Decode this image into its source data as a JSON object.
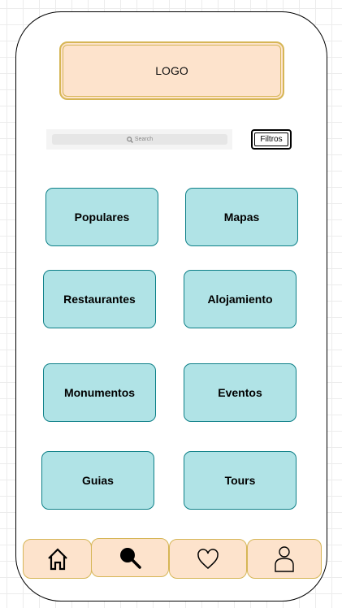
{
  "header": {
    "logo_text": "LOGO"
  },
  "search": {
    "placeholder": "Search",
    "icon": "search-icon"
  },
  "filters": {
    "label": "Filtros"
  },
  "categories": [
    {
      "label": "Populares"
    },
    {
      "label": "Mapas"
    },
    {
      "label": "Restaurantes"
    },
    {
      "label": "Alojamiento"
    },
    {
      "label": "Monumentos"
    },
    {
      "label": "Eventos"
    },
    {
      "label": "Guias"
    },
    {
      "label": "Tours"
    }
  ],
  "bottom_nav": {
    "items": [
      {
        "icon": "home-icon"
      },
      {
        "icon": "search-icon"
      },
      {
        "icon": "heart-icon"
      },
      {
        "icon": "user-icon"
      }
    ]
  },
  "colors": {
    "category_fill": "#b0e3e6",
    "category_border": "#0e8088",
    "logo_fill": "#fde3cc",
    "logo_border": "#d6b656",
    "nav_fill": "#fde3cc"
  }
}
